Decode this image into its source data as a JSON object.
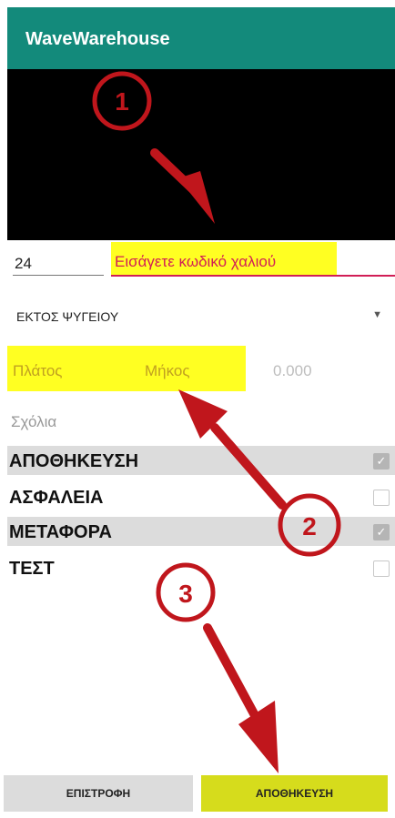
{
  "app": {
    "title": "WaveWarehouse"
  },
  "scan": {
    "count_value": "24",
    "code_placeholder": "Εισάγετε κωδικό χαλιού"
  },
  "location": {
    "selected": "ΕΚΤΟΣ ΨΥΓΕΙΟΥ"
  },
  "dimensions": {
    "width_label": "Πλάτος",
    "length_label": "Μήκος",
    "value": "0.000"
  },
  "comments": {
    "placeholder": "Σχόλια"
  },
  "options": [
    {
      "label": "ΑΠΟΘΗΚΕΥΣΗ",
      "checked": true
    },
    {
      "label": "ΑΣΦΑΛΕΙΑ",
      "checked": false
    },
    {
      "label": "ΜΕΤΑΦΟΡΑ",
      "checked": true
    },
    {
      "label": "ΤΕΣΤ",
      "checked": false
    }
  ],
  "actions": {
    "back_label": "ΕΠΙΣΤΡΟΦΗ",
    "save_label": "ΑΠΟΘΗΚΕΥΣΗ"
  },
  "annotations": {
    "step1": "1",
    "step2": "2",
    "step3": "3",
    "marker_color": "#c0161c"
  },
  "colors": {
    "appbar": "#138a7b",
    "highlight": "#ffff22",
    "accent": "#d11e56",
    "save_button": "#d6dc1c"
  }
}
